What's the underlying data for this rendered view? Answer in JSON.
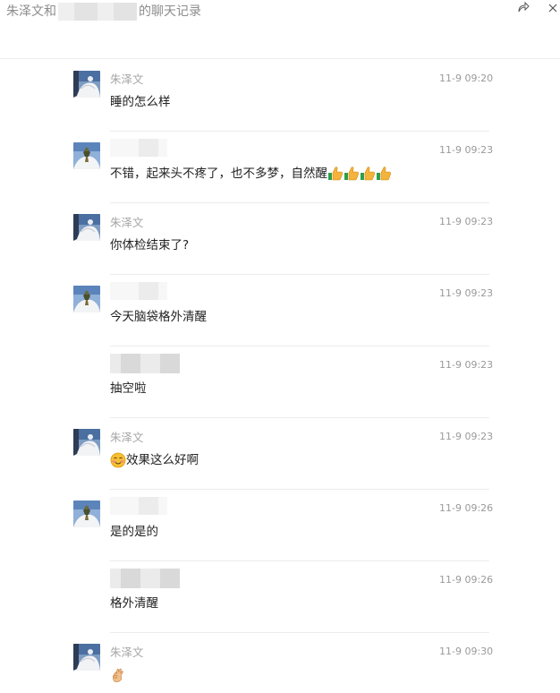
{
  "window": {
    "title_prefix": "朱泽文和",
    "title_suffix": "的聊天记录",
    "share_icon": "share-icon",
    "close_icon": "close-icon"
  },
  "messages": [
    {
      "sender": "朱泽文",
      "sender_hidden": false,
      "avatar": "avatar-a",
      "time": "11-9 09:20",
      "text": "睡的怎么样",
      "emojis": []
    },
    {
      "sender": "",
      "sender_hidden": true,
      "avatar": "avatar-b",
      "time": "11-9 09:23",
      "text": "不错，起来头不疼了，也不多梦，自然醒",
      "emojis": [
        "thumbs-up-icon",
        "thumbs-up-icon",
        "thumbs-up-icon",
        "thumbs-up-icon"
      ]
    },
    {
      "sender": "朱泽文",
      "sender_hidden": false,
      "avatar": "avatar-a",
      "time": "11-9 09:23",
      "text": "你体检结束了?",
      "emojis": []
    },
    {
      "sender": "",
      "sender_hidden": true,
      "avatar": "avatar-b",
      "time": "11-9 09:23",
      "text": "今天脑袋格外清醒",
      "emojis": []
    },
    {
      "sender": "",
      "sender_hidden": true,
      "avatar": "",
      "time": "11-9 09:23",
      "text": "抽空啦",
      "emojis": []
    },
    {
      "sender": "朱泽文",
      "sender_hidden": false,
      "avatar": "avatar-a",
      "time": "11-9 09:23",
      "text": "效果这么好啊",
      "emojis_before": [
        "smile-face-icon"
      ],
      "emojis": []
    },
    {
      "sender": "",
      "sender_hidden": true,
      "avatar": "avatar-b",
      "time": "11-9 09:26",
      "text": "是的是的",
      "emojis": []
    },
    {
      "sender": "",
      "sender_hidden": true,
      "avatar": "",
      "time": "11-9 09:26",
      "text": "格外清醒",
      "emojis": []
    },
    {
      "sender": "朱泽文",
      "sender_hidden": false,
      "avatar": "avatar-a",
      "time": "11-9 09:30",
      "text": "",
      "emojis": [
        "ok-hand-icon"
      ]
    }
  ]
}
